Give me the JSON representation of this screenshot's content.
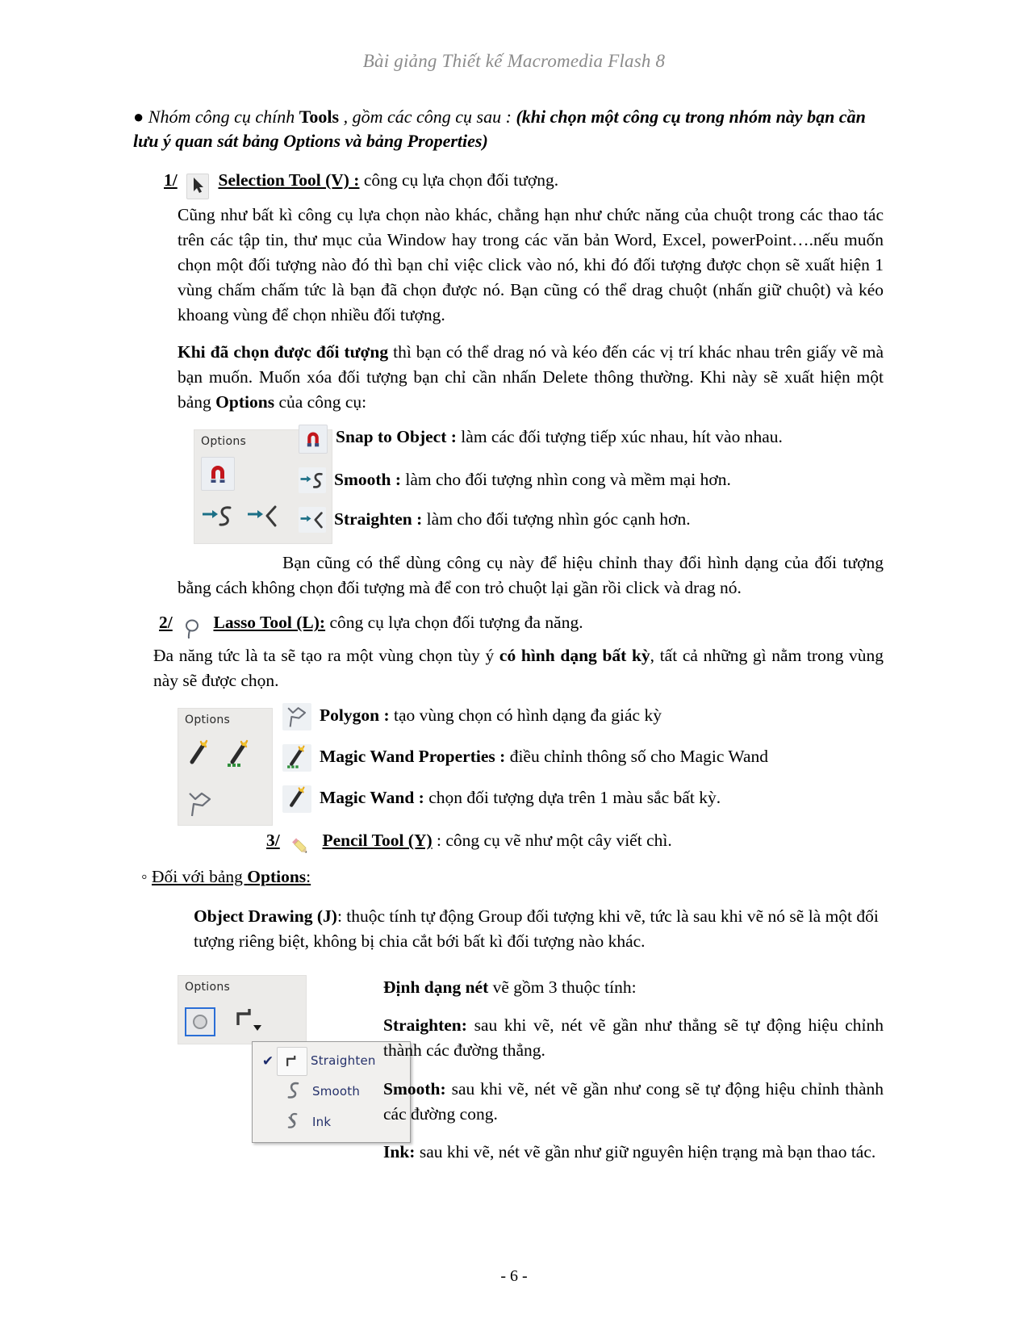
{
  "header": {
    "running_title": "Bài giảng Thiết kế Macromedia Flash 8"
  },
  "intro": {
    "bullet": "●",
    "text_1": "Nhóm công cụ chính ",
    "bold_1": "Tools",
    "text_2": " , gồm các công cụ sau : ",
    "italic_bold_1": "(khi chọn một công cụ trong nhóm này bạn cần lưu ý quan sát bảng ",
    "italic_bold_2": "Options",
    "italic_bold_3": " và bảng ",
    "italic_bold_4": "Properties)"
  },
  "tool1": {
    "number": "1/",
    "icon": "arrow-cursor-icon",
    "label": "Selection  Tool (V) :",
    "desc": " công cụ lựa chọn đối tượng.",
    "para1": "Cũng như bất kì công cụ lựa chọn nào khác, chẳng hạn như chức năng của chuột trong các thao tác trên các tập tin, thư mục của Window hay trong các văn bản Word, Excel, powerPoint….nếu muốn chọn một đối tượng nào đó thì bạn chỉ việc click vào nó, khi đó đối tượng được chọn sẽ xuất hiện 1 vùng chấm chấm tức là bạn đã chọn được nó. Bạn cũng có thể drag chuột (nhấn giữ chuột) và kéo khoang vùng để chọn nhiều đối tượng.",
    "para2_bold": "Khi đã chọn được đối tượng",
    "para2_a": " thì bạn có thể drag nó và kéo đến các vị trí khác nhau trên giấy vẽ mà bạn muốn. Muốn xóa đối tượng bạn chỉ cần nhấn Delete thông thường. Khi này sẽ xuất hiện một bảng ",
    "para2_bold2": "Options",
    "para2_b": " của công cụ:",
    "options_panel_title": "Options",
    "options": [
      {
        "icon": "magnet-icon",
        "name": "Snap to Object",
        "sep": " : ",
        "desc": "làm các đối tượng tiếp xúc nhau, hít vào nhau."
      },
      {
        "icon": "smooth-curve-icon",
        "name": "Smooth",
        "sep": " : ",
        "desc": "làm cho đối tượng nhìn cong và mềm mại hơn."
      },
      {
        "icon": "straighten-curve-icon",
        "name": "Straighten",
        "sep": " : ",
        "desc": "làm cho đối tượng nhìn góc cạnh hơn."
      }
    ],
    "para3": "Bạn cũng có thể dùng công cụ này để hiệu chỉnh thay đổi hình dạng của đối tượng bằng cách không chọn đối tượng mà để con trỏ chuột lại gần rồi click và drag nó."
  },
  "tool2": {
    "number": "2/",
    "icon": "lasso-icon",
    "label": "Lasso Tool (L):",
    "desc": " công cụ lựa chọn đối tượng đa năng.",
    "para1_a": "Đa năng tức là ta sẽ tạo ra một vùng chọn tùy ý ",
    "para1_bold": "có hình dạng bất kỳ",
    "para1_b": ", tất cả những gì nằm trong vùng này sẽ được chọn.",
    "options_panel_title": "Options",
    "options": [
      {
        "icon": "polygon-lasso-icon",
        "name": "Polygon",
        "sep": " : ",
        "desc": "tạo vùng chọn có hình dạng đa giác kỳ"
      },
      {
        "icon": "magic-wand-properties-icon",
        "name": "Magic Wand Properties",
        "sep": " : ",
        "desc": "điều chỉnh thông số cho Magic Wand"
      },
      {
        "icon": "magic-wand-icon",
        "name": "Magic Wand",
        "sep": " : ",
        "desc": "chọn đối tượng dựa trên 1 màu sắc bất kỳ."
      }
    ]
  },
  "tool3": {
    "number": "3/",
    "icon": "pencil-icon",
    "label": "Pencil Tool (Y)",
    "sep": " : ",
    "desc": "công cụ vẽ như một cây viết chì.",
    "subhead_mark": "◦ ",
    "subhead_a": "Đối với bảng ",
    "subhead_bold": "Options",
    "subhead_b": ":",
    "object_drawing_bold": "Object Drawing (J)",
    "object_drawing_text": ": thuộc tính tự động Group đối tượng khi vẽ, tức là sau khi vẽ nó sẽ là một đối tượng riêng biệt, không bị chia cắt bới bất kì đối tượng nào khác.",
    "dinhdang_bold": "Định dạng nét",
    "dinhdang_text": " vẽ gồm 3 thuộc tính:",
    "items": [
      {
        "bold": "Straighten:",
        "text": " sau khi vẽ, nét vẽ gần như thẳng sẽ tự động hiệu chỉnh thành các đường thẳng."
      },
      {
        "bold": "Smooth:",
        "text": " sau khi vẽ, nét vẽ gần như cong sẽ tự động hiệu chỉnh thành các đường cong."
      },
      {
        "bold": "Ink:",
        "text": " sau khi vẽ, nét vẽ gần như giữ nguyên hiện trạng mà bạn thao tác."
      }
    ],
    "options_panel_title": "Options",
    "toolbar": [
      {
        "icon": "object-drawing-icon",
        "selected": true
      },
      {
        "icon": "straighten-mode-icon",
        "selected": false,
        "has_dropdown": true
      }
    ],
    "menu": [
      {
        "icon": "straighten-mode-icon",
        "label": "Straighten",
        "checked": true
      },
      {
        "icon": "smooth-mode-icon",
        "label": "Smooth",
        "checked": false
      },
      {
        "icon": "ink-mode-icon",
        "label": "Ink",
        "checked": false
      }
    ]
  },
  "footer": {
    "page_number": "- 6 -"
  },
  "colors": {
    "header_gray": "#8b8b8b",
    "panel_bg": "#ecebe9",
    "menu_text": "#25316b",
    "magnet_red": "#c2161c",
    "accent_teal": "#1b6f86",
    "selection_blue": "#2a6ed6"
  }
}
